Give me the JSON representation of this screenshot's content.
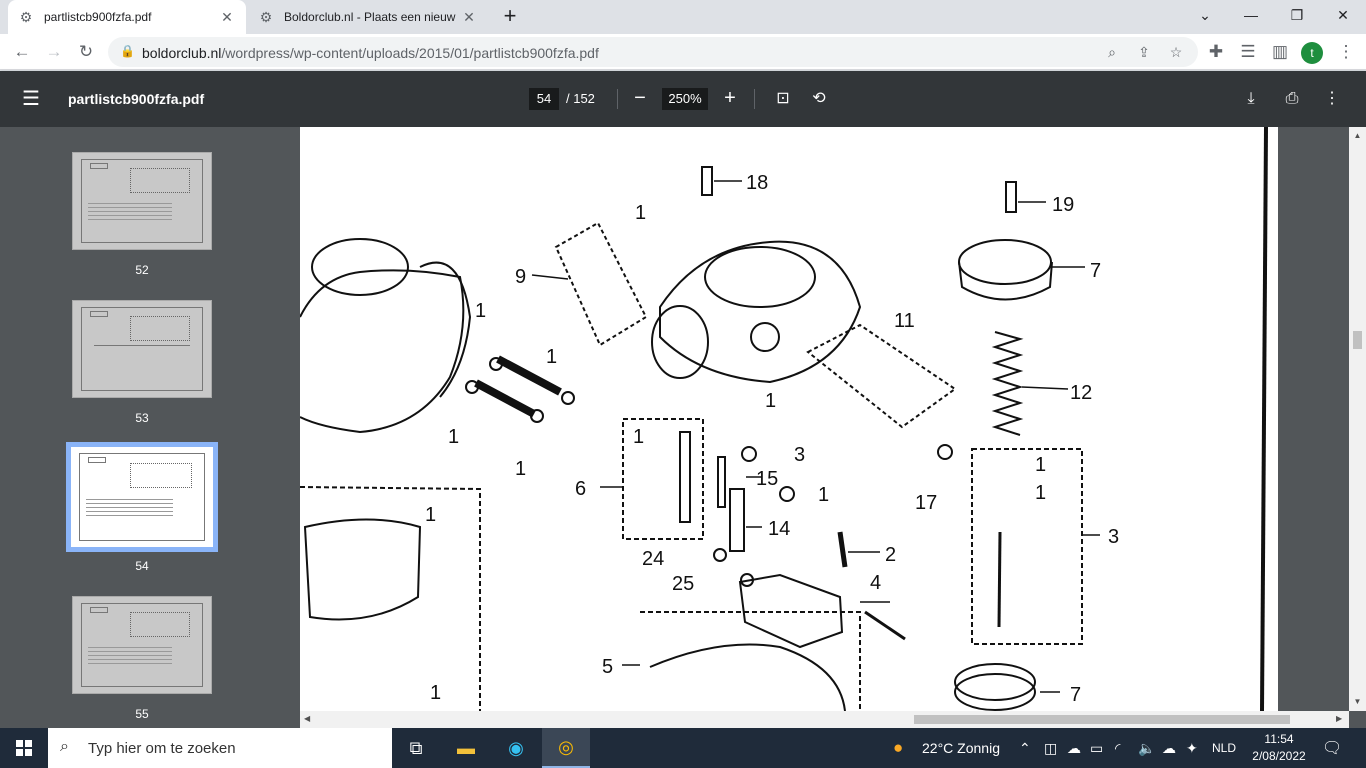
{
  "browser": {
    "tabs": [
      {
        "title": "partlistcb900fzfa.pdf",
        "active": true
      },
      {
        "title": "Boldorclub.nl - Plaats een nieuw",
        "active": false
      }
    ],
    "url_host": "boldorclub.nl",
    "url_path": "/wordpress/wp-content/uploads/2015/01/partlistcb900fzfa.pdf",
    "profile_initial": "t"
  },
  "pdf": {
    "filename": "partlistcb900fzfa.pdf",
    "current_page": "54",
    "total_pages": "/ 152",
    "zoom": "250%"
  },
  "thumbnails": [
    {
      "label": "52",
      "selected": false
    },
    {
      "label": "53",
      "selected": false
    },
    {
      "label": "54",
      "selected": true
    },
    {
      "label": "55",
      "selected": false
    }
  ],
  "diagram": {
    "callouts": [
      "18",
      "19",
      "9",
      "11",
      "12",
      "17",
      "6",
      "15",
      "14",
      "2",
      "24",
      "25",
      "4",
      "5",
      "3",
      "3",
      "3",
      "7",
      "7",
      "1",
      "1",
      "1",
      "1",
      "1",
      "1",
      "1",
      "1",
      "1",
      "1",
      "1",
      "1",
      "1"
    ]
  },
  "taskbar": {
    "search_placeholder": "Typ hier om te zoeken",
    "weather": "22°C  Zonnig",
    "language": "NLD",
    "time": "11:54",
    "date": "2/08/2022"
  },
  "colors": {
    "pdf_toolbar": "#323639",
    "sidebar": "#525659",
    "accent": "#8ab4f8"
  }
}
